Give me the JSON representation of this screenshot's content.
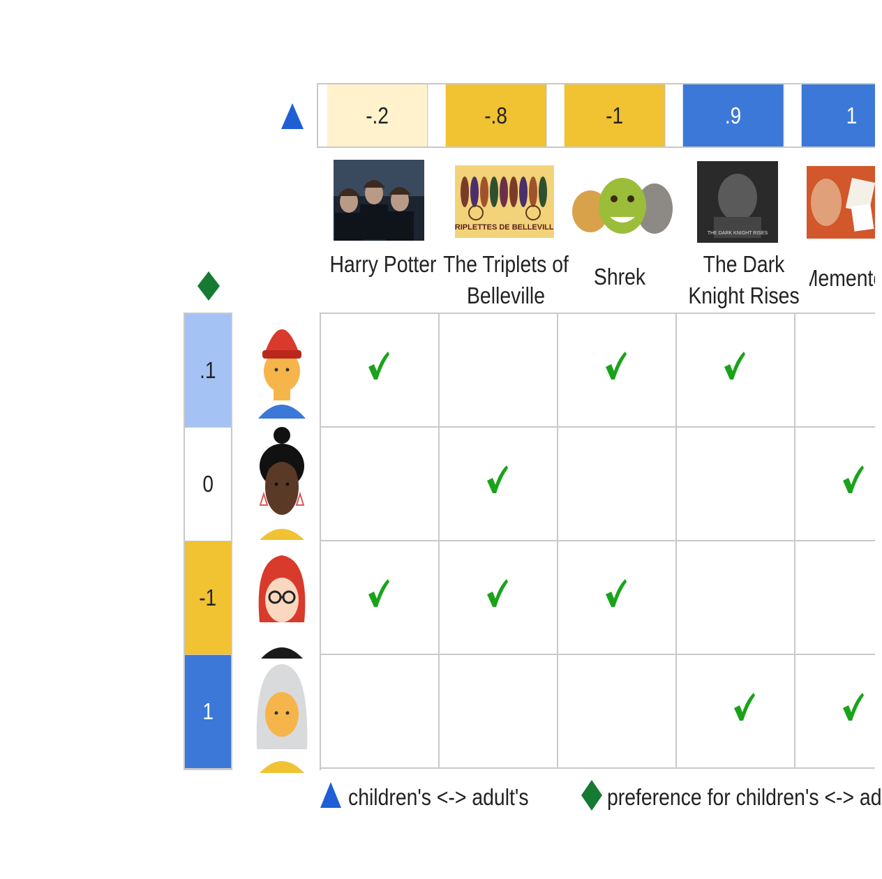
{
  "colors": {
    "blue": "#3b78d8",
    "light_blue": "#a4c2f4",
    "yellow": "#f1c232",
    "pale_yellow": "#fff2cc",
    "green_check": "#1aa31a",
    "triangle": "#1f5fd6",
    "diamond": "#167a32"
  },
  "movie_axis_icon": "triangle-icon",
  "user_axis_icon": "diamond-icon",
  "movies": [
    {
      "title_line1": "Harry Potter",
      "title_line2": "",
      "score": "-.2",
      "score_color": "#fff2cc",
      "poster": "harry-potter-poster"
    },
    {
      "title_line1": "The Triplets of",
      "title_line2": "Belleville",
      "score": "-.8",
      "score_color": "#f1c232",
      "poster": "triplets-poster",
      "poster_text": "TRIPLETTES DE BELLEVILLE"
    },
    {
      "title_line1": "Shrek",
      "title_line2": "",
      "score": "-1",
      "score_color": "#f1c232",
      "poster": "shrek-poster"
    },
    {
      "title_line1": "The Dark",
      "title_line2": "Knight Rises",
      "score": ".9",
      "score_color": "#3b78d8",
      "poster": "dark-knight-poster",
      "poster_text": "THE DARK KNIGHT RISES"
    },
    {
      "title_line1": "Memento",
      "title_line2": "",
      "score": "1",
      "score_color": "#3b78d8",
      "poster": "memento-poster"
    }
  ],
  "users": [
    {
      "score": ".1",
      "score_color": "#a4c2f4",
      "avatar": "user-red-beanie-avatar",
      "checks": [
        true,
        false,
        true,
        true,
        false
      ]
    },
    {
      "score": "0",
      "score_color": "#ffffff",
      "avatar": "user-bun-hair-avatar",
      "checks": [
        false,
        true,
        false,
        false,
        true
      ]
    },
    {
      "score": "-1",
      "score_color": "#f1c232",
      "avatar": "user-red-hair-glasses-avatar",
      "checks": [
        true,
        true,
        true,
        false,
        false
      ]
    },
    {
      "score": "1",
      "score_color": "#3b78d8",
      "avatar": "user-gray-hair-avatar",
      "checks": [
        false,
        false,
        false,
        true,
        true
      ]
    }
  ],
  "legend": {
    "movie_axis": "children's <-> adult's",
    "user_axis": "preference for children's <-> adult"
  }
}
